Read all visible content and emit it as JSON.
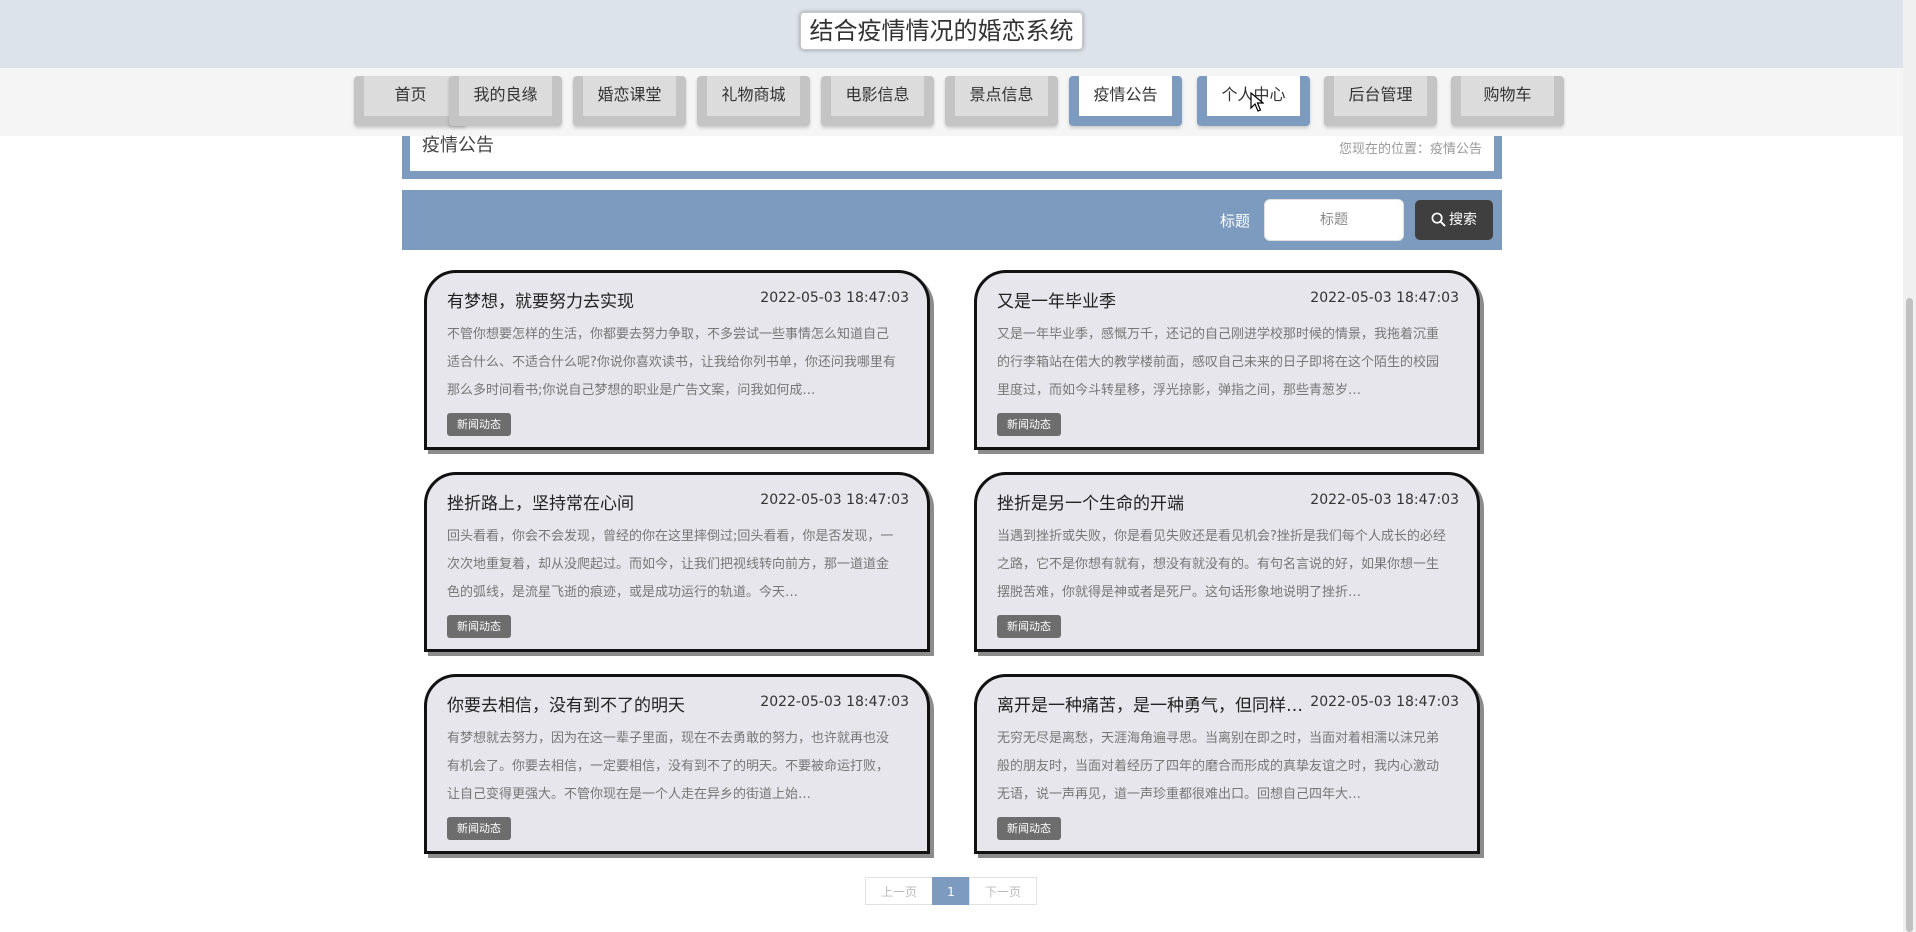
{
  "site": {
    "title": "结合疫情情况的婚恋系统"
  },
  "nav": {
    "items": [
      {
        "label": "首页",
        "active": false
      },
      {
        "label": "我的良缘",
        "active": false
      },
      {
        "label": "婚恋课堂",
        "active": false
      },
      {
        "label": "礼物商城",
        "active": false
      },
      {
        "label": "电影信息",
        "active": false
      },
      {
        "label": "景点信息",
        "active": false
      },
      {
        "label": "疫情公告",
        "active": true
      },
      {
        "label": "个人中心",
        "active": true
      },
      {
        "label": "后台管理",
        "active": false
      },
      {
        "label": "购物车",
        "active": false
      }
    ]
  },
  "breadcrumb": {
    "title": "疫情公告",
    "location": "您现在的位置：疫情公告"
  },
  "search": {
    "label": "标题",
    "placeholder": "标题",
    "button": "搜索"
  },
  "news": [
    {
      "title": "有梦想，就要努力去实现",
      "date": "2022-05-03 18:47:03",
      "summary": "不管你想要怎样的生活，你都要去努力争取，不多尝试一些事情怎么知道自己适合什么、不适合什么呢?你说你喜欢读书，让我给你列书单，你还问我哪里有那么多时间看书;你说自己梦想的职业是广告文案，问我如何成…",
      "tag": "新闻动态"
    },
    {
      "title": "又是一年毕业季",
      "date": "2022-05-03 18:47:03",
      "summary": "又是一年毕业季，感慨万千，还记的自己刚进学校那时候的情景，我拖着沉重的行李箱站在偌大的教学楼前面，感叹自己未来的日子即将在这个陌生的校园里度过，而如今斗转星移，浮光掠影，弹指之间，那些青葱岁…",
      "tag": "新闻动态"
    },
    {
      "title": "挫折路上，坚持常在心间",
      "date": "2022-05-03 18:47:03",
      "summary": "回头看看，你会不会发现，曾经的你在这里摔倒过;回头看看，你是否发现，一次次地重复着，却从没爬起过。而如今，让我们把视线转向前方，那一道道金色的弧线，是流星飞逝的痕迹，或是成功运行的轨道。今天…",
      "tag": "新闻动态"
    },
    {
      "title": "挫折是另一个生命的开端",
      "date": "2022-05-03 18:47:03",
      "summary": "当遇到挫折或失败，你是看见失败还是看见机会?挫折是我们每个人成长的必经之路，它不是你想有就有，想没有就没有的。有句名言说的好，如果你想一生摆脱苦难，你就得是神或者是死尸。这句话形象地说明了挫折…",
      "tag": "新闻动态"
    },
    {
      "title": "你要去相信，没有到不了的明天",
      "date": "2022-05-03 18:47:03",
      "summary": "有梦想就去努力，因为在这一辈子里面，现在不去勇敢的努力，也许就再也没有机会了。你要去相信，一定要相信，没有到不了的明天。不要被命运打败，让自己变得更强大。不管你现在是一个人走在异乡的街道上始…",
      "tag": "新闻动态"
    },
    {
      "title": "离开是一种痛苦，是一种勇气，但同样也是一个考验",
      "date": "2022-05-03 18:47:03",
      "summary": "无穷无尽是离愁，天涯海角遍寻思。当离别在即之时，当面对着相濡以沫兄弟般的朋友时，当面对着经历了四年的磨合而形成的真挚友谊之时，我内心激动无语，说一声再见，道一声珍重都很难出口。回想自己四年大…",
      "tag": "新闻动态"
    }
  ],
  "pagination": {
    "prev": "上一页",
    "current": "1",
    "next": "下一页"
  }
}
